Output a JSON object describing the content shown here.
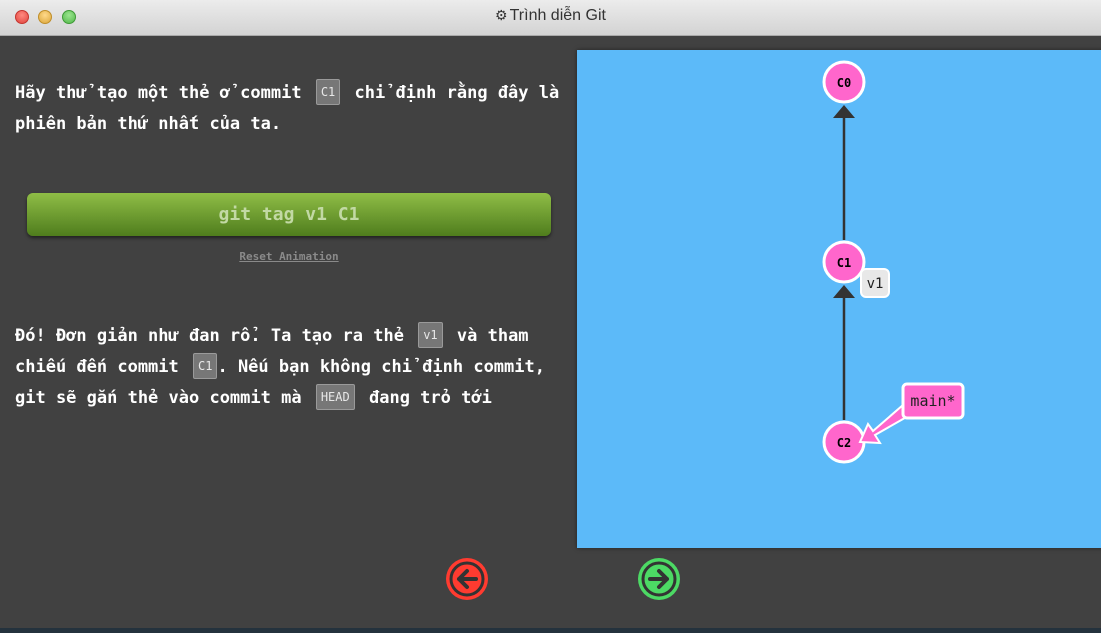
{
  "window": {
    "title": "Trình diễn Git",
    "title_icon": "gear-icon"
  },
  "lesson": {
    "intro_before": "Hãy thử tạo một thẻ ở commit",
    "intro_ref": "C1",
    "intro_after": "chỉ định rằng đây là phiên bản thứ nhất của ta.",
    "command": "git tag v1 C1",
    "reset_label": "Reset Animation",
    "outro_part1": "Đó! Đơn giản như đan rổ. Ta tạo ra thẻ",
    "outro_ref1": "v1",
    "outro_part2": "và tham chiếu đến commit",
    "outro_ref2": "C1",
    "outro_part3": ". Nếu bạn không chỉ định commit, git sẽ gắn thẻ vào commit mà",
    "outro_ref3": "HEAD",
    "outro_part4": "đang trỏ tới"
  },
  "graph": {
    "commits": [
      {
        "id": "C0"
      },
      {
        "id": "C1"
      },
      {
        "id": "C2"
      }
    ],
    "tag": "v1",
    "branch": "main*"
  },
  "nav": {
    "back_icon": "arrow-left-icon",
    "forward_icon": "arrow-right-icon"
  },
  "colors": {
    "canvas": "#5cbaf9",
    "commit": "#ff66cc",
    "back_button": "#ff3b30",
    "forward_button": "#4cd964",
    "command_button": "#6b9a2f"
  }
}
